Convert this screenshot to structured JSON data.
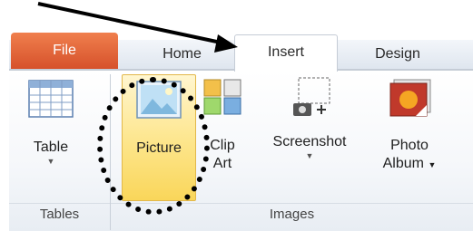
{
  "tabs": [
    {
      "label": "File"
    },
    {
      "label": "Home"
    },
    {
      "label": "Insert"
    },
    {
      "label": "Design"
    }
  ],
  "buttons": {
    "table": {
      "label": "Table"
    },
    "picture": {
      "label": "Picture"
    },
    "clip_art": {
      "label_line1": "Clip",
      "label_line2": "Art"
    },
    "screenshot": {
      "label": "Screenshot"
    },
    "photo_album": {
      "label_line1": "Photo",
      "label_line2": "Album"
    }
  },
  "groups": {
    "tables": "Tables",
    "images": "Images"
  },
  "colors": {
    "file_tab": "#d6512b",
    "picture_highlight": "#fde58a"
  }
}
